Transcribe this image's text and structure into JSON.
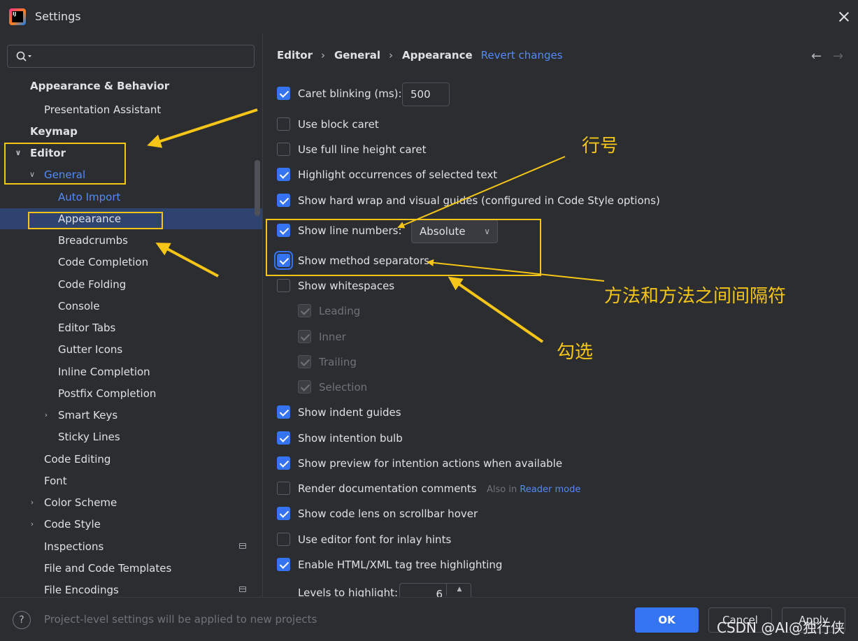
{
  "window": {
    "title": "Settings",
    "app_icon_text": "IJ"
  },
  "sidebar": {
    "search_placeholder": "",
    "items": [
      {
        "label": "Appearance & Behavior",
        "bold": true
      },
      {
        "label": "Presentation Assistant"
      },
      {
        "label": "Keymap",
        "bold": true
      },
      {
        "label": "Editor",
        "bold": true,
        "expanded": true
      },
      {
        "label": "General",
        "expanded": true
      },
      {
        "label": "Auto Import"
      },
      {
        "label": "Appearance",
        "selected": true
      },
      {
        "label": "Breadcrumbs"
      },
      {
        "label": "Code Completion"
      },
      {
        "label": "Code Folding"
      },
      {
        "label": "Console"
      },
      {
        "label": "Editor Tabs"
      },
      {
        "label": "Gutter Icons"
      },
      {
        "label": "Inline Completion"
      },
      {
        "label": "Postfix Completion"
      },
      {
        "label": "Smart Keys",
        "collapsed": true
      },
      {
        "label": "Sticky Lines"
      },
      {
        "label": "Code Editing"
      },
      {
        "label": "Font"
      },
      {
        "label": "Color Scheme",
        "collapsed": true
      },
      {
        "label": "Code Style",
        "collapsed": true
      },
      {
        "label": "Inspections",
        "project_icon": true
      },
      {
        "label": "File and Code Templates"
      },
      {
        "label": "File Encodings",
        "project_icon": true
      }
    ]
  },
  "breadcrumb": {
    "items": [
      "Editor",
      "General",
      "Appearance"
    ],
    "separator": "›",
    "revert_label": "Revert changes"
  },
  "nav": {
    "back": "←",
    "forward": "→"
  },
  "options": [
    {
      "label": "Caret blinking (ms):",
      "checked": true
    },
    {
      "label": "Use block caret",
      "checked": false
    },
    {
      "label": "Use full line height caret",
      "checked": false
    },
    {
      "label": "Highlight occurrences of selected text",
      "checked": true
    },
    {
      "label": "Show hard wrap and visual guides (configured in Code Style options)",
      "checked": true
    },
    {
      "label": "Show line numbers:",
      "checked": true
    },
    {
      "label": "Show method separators",
      "checked": true,
      "focused": true
    },
    {
      "label": "Show whitespaces",
      "checked": false
    },
    {
      "label": "Leading",
      "checked": true,
      "disabled": true
    },
    {
      "label": "Inner",
      "checked": true,
      "disabled": true
    },
    {
      "label": "Trailing",
      "checked": true,
      "disabled": true
    },
    {
      "label": "Selection",
      "checked": true,
      "disabled": true
    },
    {
      "label": "Show indent guides",
      "checked": true
    },
    {
      "label": "Show intention bulb",
      "checked": true
    },
    {
      "label": "Show preview for intention actions when available",
      "checked": true
    },
    {
      "label": "Render documentation comments",
      "checked": false
    },
    {
      "label": "Show code lens on scrollbar hover",
      "checked": true
    },
    {
      "label": "Use editor font for inlay hints",
      "checked": false
    },
    {
      "label": "Enable HTML/XML tag tree highlighting",
      "checked": true
    }
  ],
  "caret_blink_value": "500",
  "line_numbers_mode": "Absolute",
  "render_docs_hint": {
    "prefix": "Also in",
    "link": "Reader mode"
  },
  "levels_to_highlight": {
    "label": "Levels to highlight:",
    "value": "6"
  },
  "footer": {
    "help": "?",
    "note": "Project-level settings will be applied to new projects",
    "ok": "OK",
    "cancel": "Cancel",
    "apply": "Apply"
  },
  "watermark": "CSDN @AI@独行侠",
  "annotations": {
    "line_numbers": "行号",
    "method_separator": "方法和方法之间间隔符",
    "check": "勾选"
  },
  "colors": {
    "accent": "#3574f0",
    "link": "#548af7",
    "selection": "#2e436e",
    "annotation": "#f5c518",
    "background": "#2b2d30"
  }
}
